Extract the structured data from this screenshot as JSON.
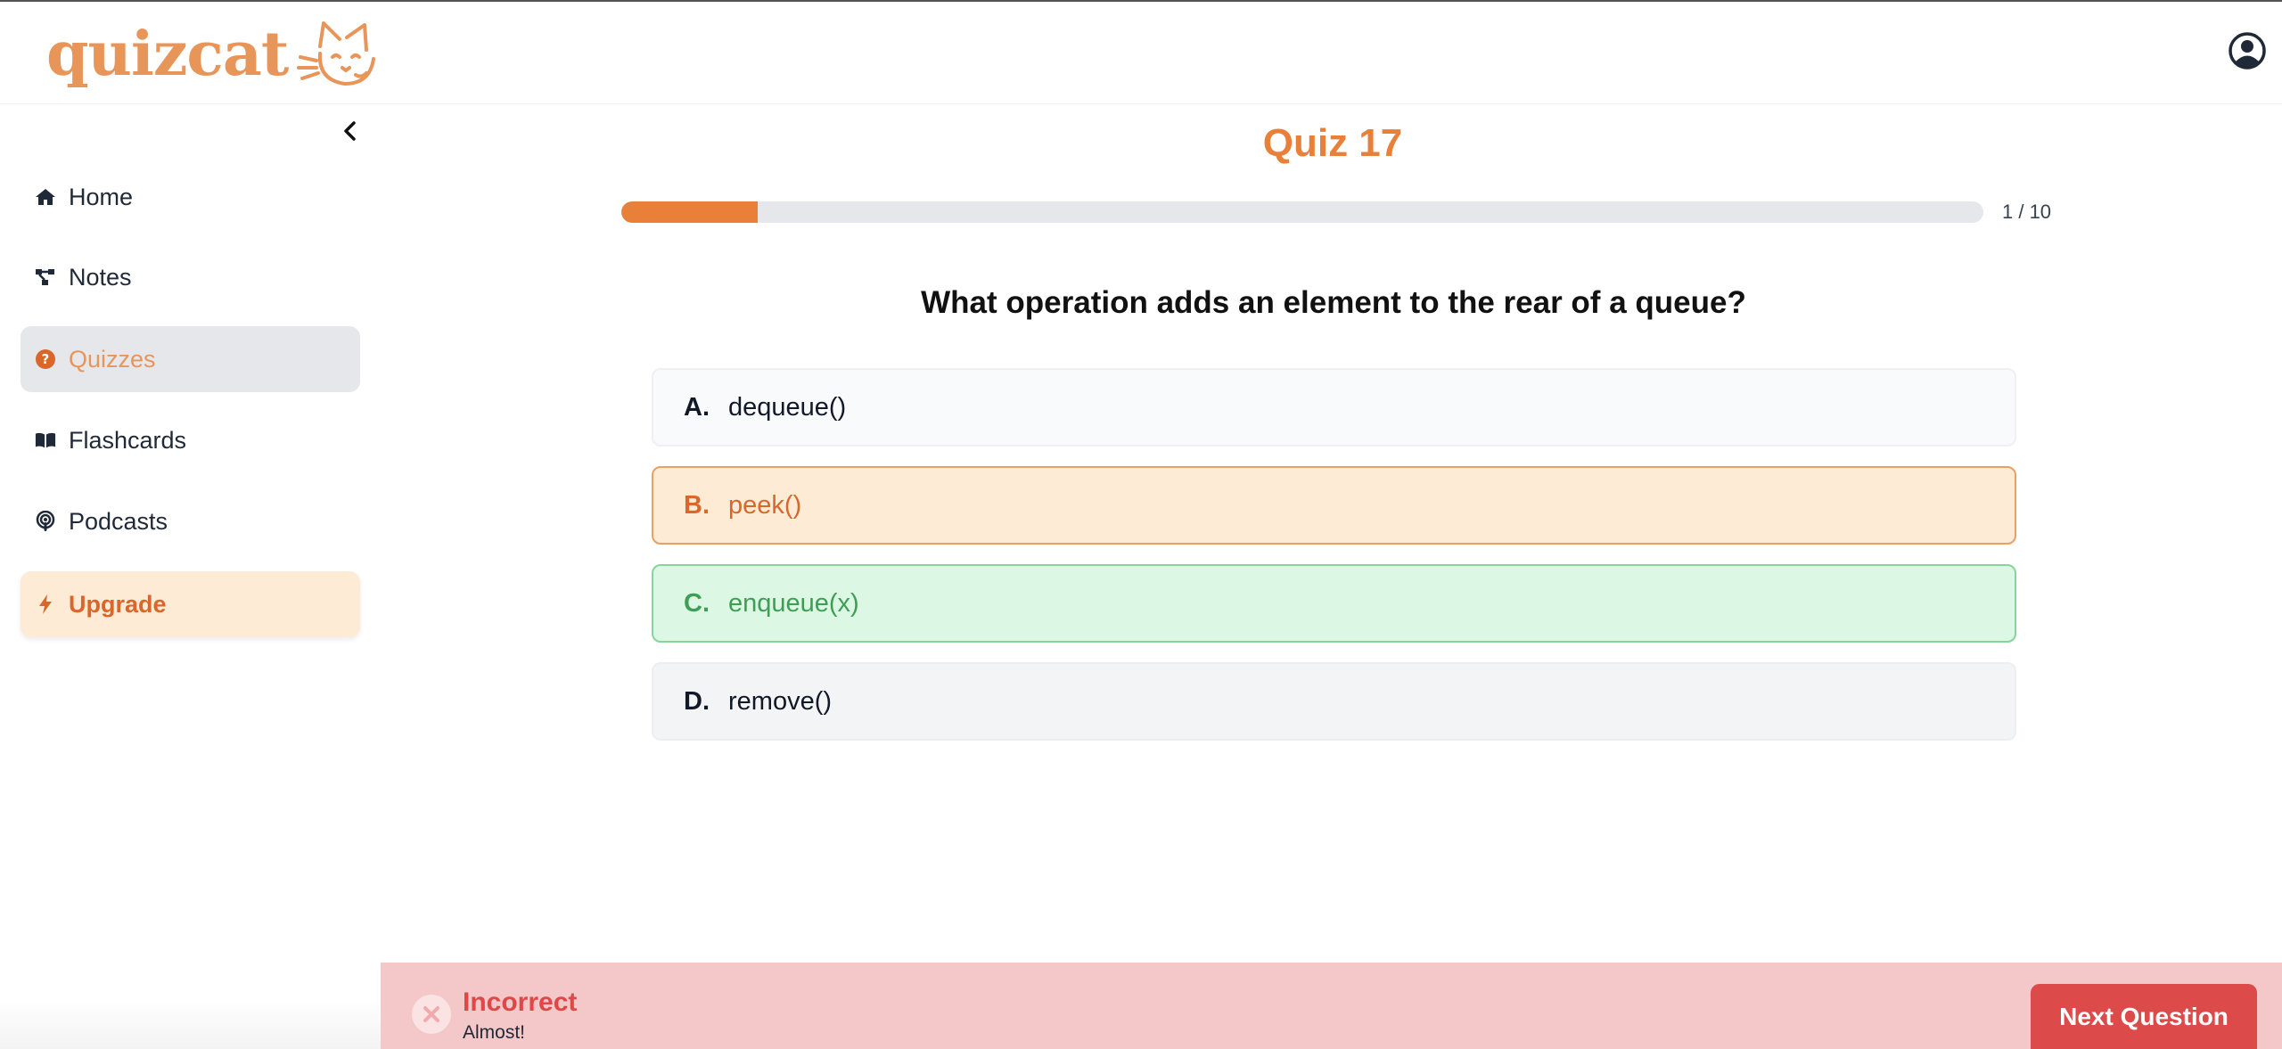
{
  "app": {
    "logo_text": "quizcat"
  },
  "sidebar": {
    "items": [
      {
        "label": "Home",
        "icon": "home-icon"
      },
      {
        "label": "Notes",
        "icon": "notes-icon"
      },
      {
        "label": "Quizzes",
        "icon": "question-circle-icon",
        "active": true
      },
      {
        "label": "Flashcards",
        "icon": "book-icon"
      },
      {
        "label": "Podcasts",
        "icon": "podcast-icon"
      },
      {
        "label": "Upgrade",
        "icon": "bolt-icon"
      }
    ]
  },
  "quiz": {
    "title": "Quiz 17",
    "progress": {
      "current": 1,
      "total": 10,
      "label": "1 / 10",
      "fraction": 0.1
    },
    "question": "What operation adds an element to the rear of a queue?",
    "options": [
      {
        "letter": "A.",
        "text": "dequeue()",
        "state": "default"
      },
      {
        "letter": "B.",
        "text": "peek()",
        "state": "selected-incorrect"
      },
      {
        "letter": "C.",
        "text": "enqueue(x)",
        "state": "correct"
      },
      {
        "letter": "D.",
        "text": "remove()",
        "state": "default"
      }
    ]
  },
  "feedback": {
    "title": "Incorrect",
    "subtitle": "Almost!",
    "next_label": "Next Question"
  },
  "colors": {
    "accent": "#e8803a",
    "incorrect": "#e04848",
    "correct": "#3f9e55"
  }
}
